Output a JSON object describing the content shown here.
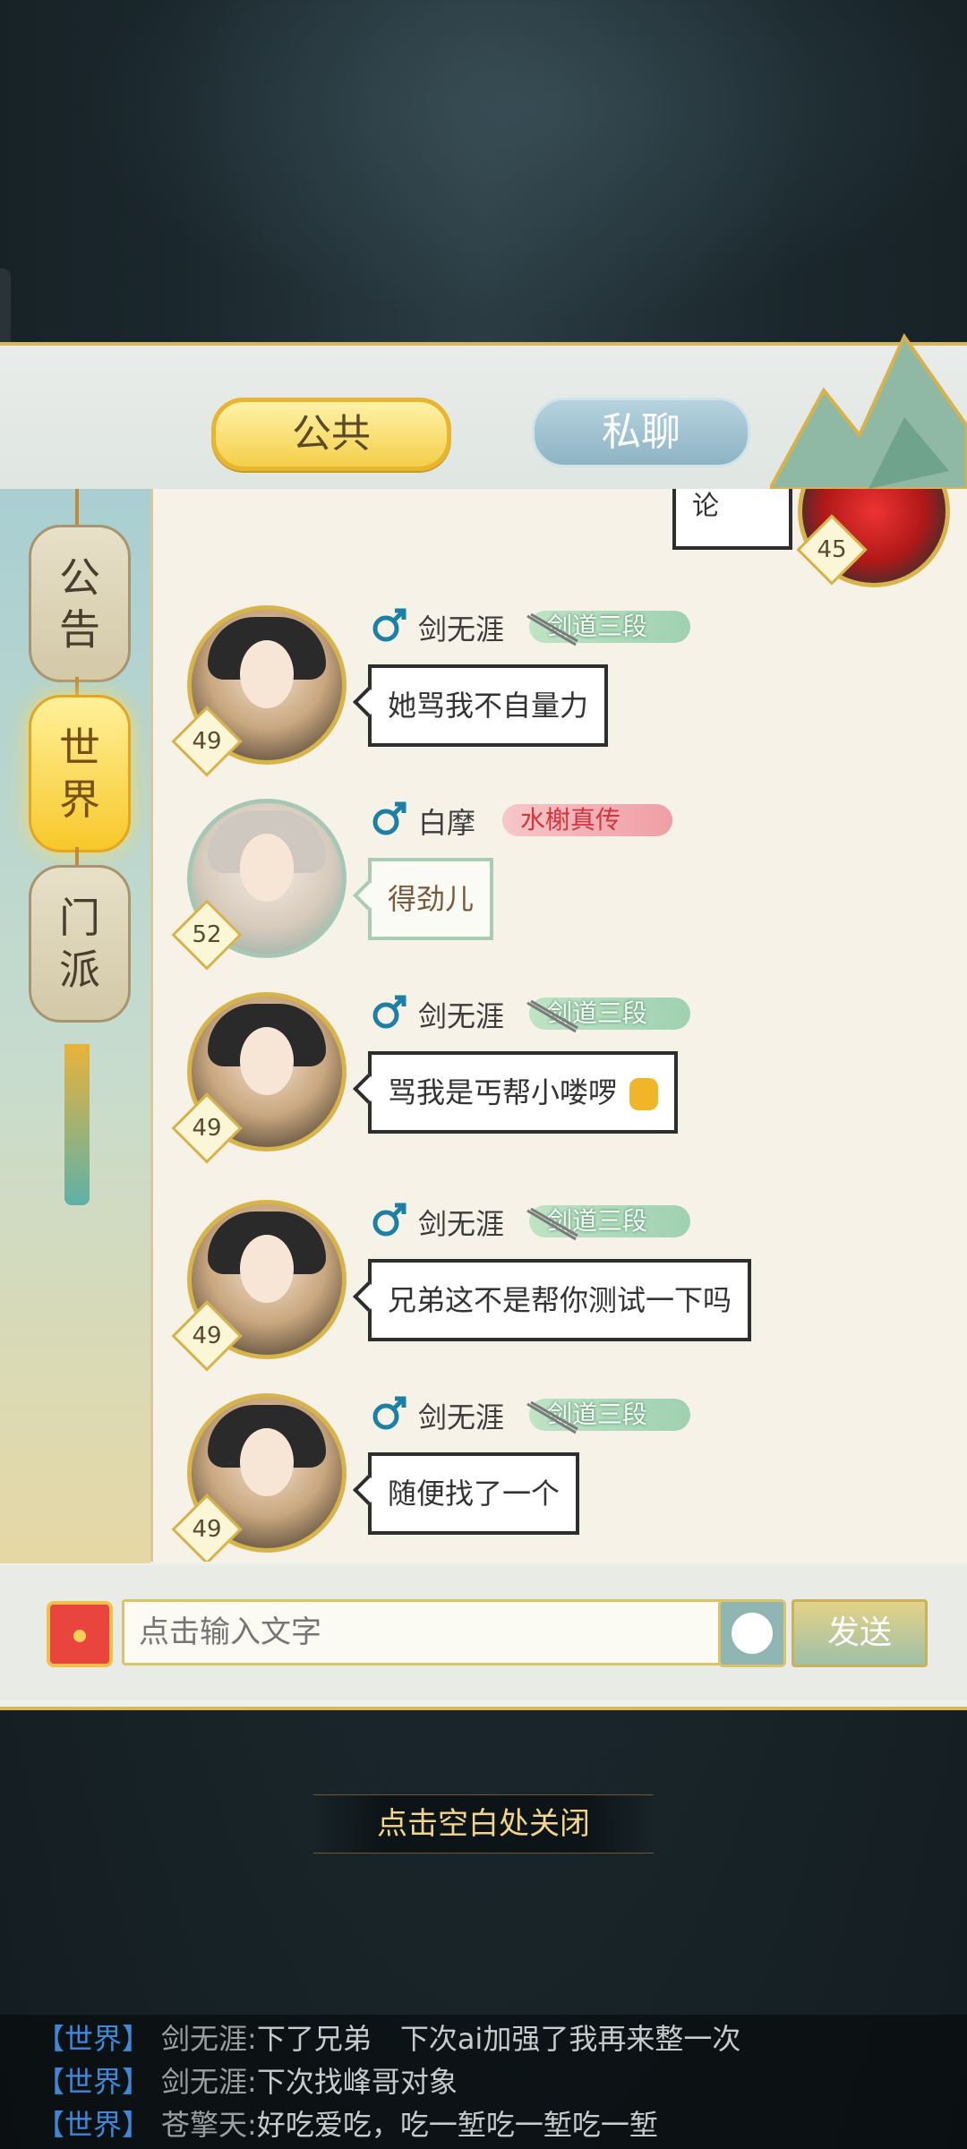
{
  "tabs": {
    "public": "公共",
    "private": "私聊"
  },
  "side_tabs": [
    {
      "label": "公告",
      "chars": [
        "公",
        "告"
      ],
      "active": false
    },
    {
      "label": "世界",
      "chars": [
        "世",
        "界"
      ],
      "active": true
    },
    {
      "label": "门派",
      "chars": [
        "门",
        "派"
      ],
      "active": false
    }
  ],
  "partial_message": {
    "text": "论",
    "level": "45"
  },
  "messages": [
    {
      "name": "剑无涯",
      "level": "49",
      "title": "剑道三段",
      "title_style": "green",
      "text": "她骂我不自量力",
      "avatar": "dark"
    },
    {
      "name": "白摩",
      "level": "52",
      "title": "水榭真传",
      "title_style": "red",
      "text": "得劲儿",
      "avatar": "white"
    },
    {
      "name": "剑无涯",
      "level": "49",
      "title": "剑道三段",
      "title_style": "green",
      "text": "骂我是丐帮小喽啰",
      "avatar": "dark"
    },
    {
      "name": "剑无涯",
      "level": "49",
      "title": "剑道三段",
      "title_style": "green",
      "text": "兄弟这不是帮你测试一下吗",
      "avatar": "dark"
    },
    {
      "name": "剑无涯",
      "level": "49",
      "title": "剑道三段",
      "title_style": "green",
      "text": "随便找了一个",
      "avatar": "dark"
    }
  ],
  "input": {
    "placeholder": "点击输入文字",
    "send_label": "发送"
  },
  "close_hint": "点击空白处关闭",
  "world_feed": [
    {
      "channel": "【世界】",
      "sender": "剑无涯:",
      "text": "下了兄弟　下次ai加强了我再来整一次"
    },
    {
      "channel": "【世界】",
      "sender": "剑无涯:",
      "text": "下次找峰哥对象"
    },
    {
      "channel": "【世界】",
      "sender": "苍擎天:",
      "text": "好吃爱吃，吃一堑吃一堑吃一堑"
    }
  ],
  "colors": {
    "accent_gold": "#d8b65a",
    "tab_active": "#f5cf4a",
    "world_channel": "#3b89d8"
  }
}
